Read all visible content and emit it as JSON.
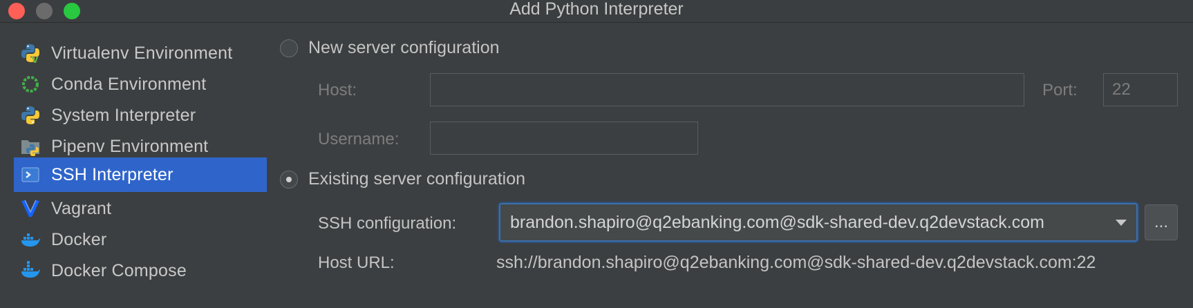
{
  "window": {
    "title": "Add Python Interpreter"
  },
  "sidebar": {
    "items": [
      {
        "label": "Virtualenv Environment",
        "icon": "python-venv-icon"
      },
      {
        "label": "Conda Environment",
        "icon": "conda-icon"
      },
      {
        "label": "System Interpreter",
        "icon": "python-icon"
      },
      {
        "label": "Pipenv Environment",
        "icon": "pipenv-icon"
      },
      {
        "label": "SSH Interpreter",
        "icon": "ssh-icon",
        "selected": true
      },
      {
        "label": "Vagrant",
        "icon": "vagrant-icon"
      },
      {
        "label": "Docker",
        "icon": "docker-icon"
      },
      {
        "label": "Docker Compose",
        "icon": "docker-compose-icon"
      }
    ]
  },
  "new_server": {
    "label": "New server configuration",
    "selected": false,
    "host_label": "Host:",
    "host_value": "",
    "port_label": "Port:",
    "port_value": "22",
    "username_label": "Username:",
    "username_value": ""
  },
  "existing_server": {
    "label": "Existing server configuration",
    "selected": true,
    "ssh_config_label": "SSH configuration:",
    "ssh_config_value": "brandon.shapiro@q2ebanking.com@sdk-shared-dev.q2devstack.com",
    "browse_label": "...",
    "host_url_label": "Host URL:",
    "host_url_value": "ssh://brandon.shapiro@q2ebanking.com@sdk-shared-dev.q2devstack.com:22"
  },
  "colors": {
    "background": "#3c3f41",
    "selection": "#2f65ca",
    "focus": "#3e6fa9"
  }
}
